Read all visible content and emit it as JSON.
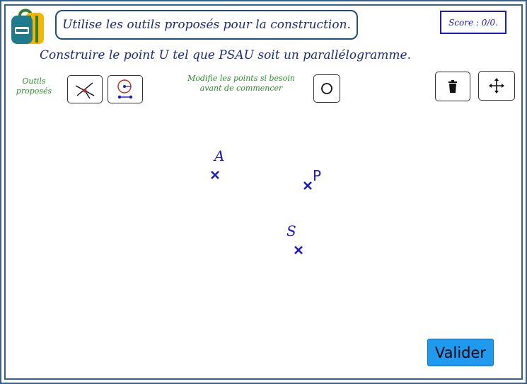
{
  "header": {
    "instruction": "Utilise les outils proposés pour la construction.",
    "score": "Score : 0/0."
  },
  "task": "Construire le point U tel que PSAU soit un parallélogramme.",
  "tools": {
    "label_line1": "Outils",
    "label_line2": "proposés",
    "modify_line1": "Modifie les points si besoin",
    "modify_line2": "avant de commencer"
  },
  "points": {
    "a_label": "A",
    "p_label": "P",
    "s_label": "S",
    "color": "#1a1acc"
  },
  "actions": {
    "validate_label": "Valider",
    "validate_color": "#1e9bf0"
  }
}
